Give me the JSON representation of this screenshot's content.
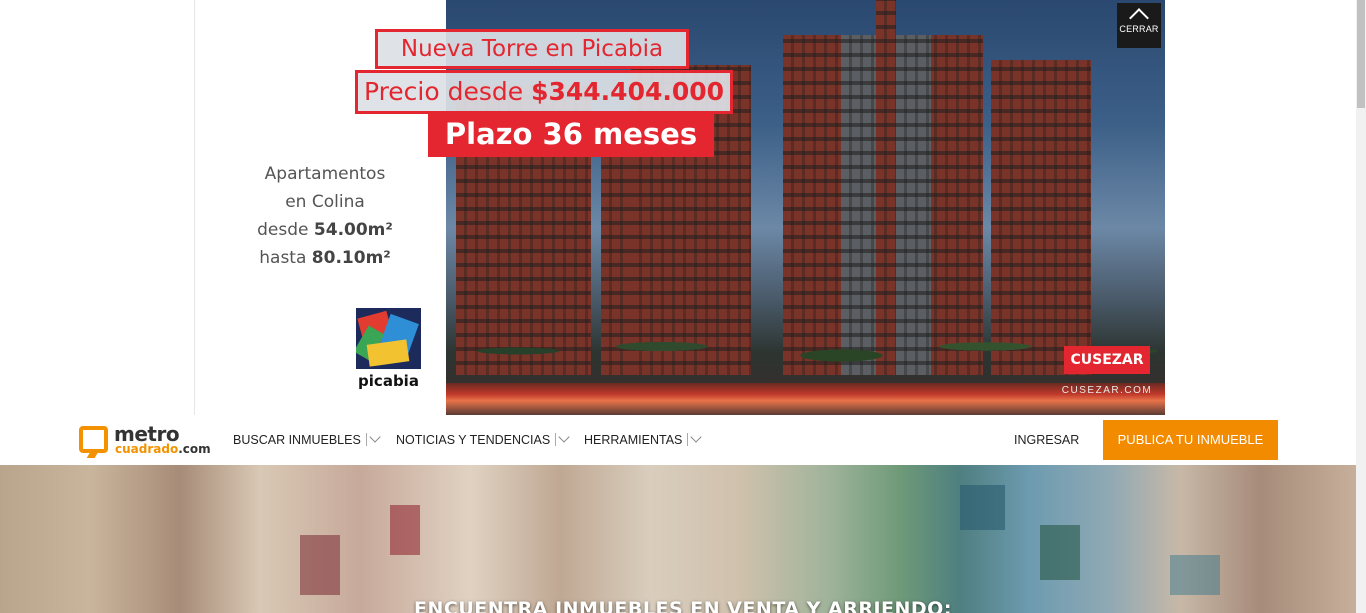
{
  "ad": {
    "headline1": "Nueva Torre en Picabia",
    "headline2_prefix": "Precio desde ",
    "headline2_price": "$344.404.000",
    "headline3": "Plazo 36 meses",
    "copy_line1": "Apartamentos",
    "copy_line2": "en Colina",
    "copy_line3_prefix": "desde ",
    "copy_line3_value": "54.00m²",
    "copy_line4_prefix": "hasta ",
    "copy_line4_value": "80.10m²",
    "project_logo": "picabia",
    "close_label": "CERRAR",
    "brand_logo": "CUSEZAR",
    "brand_url": "CUSEZAR.COM",
    "colors": {
      "accent_red": "#e3262f"
    }
  },
  "header": {
    "logo_top": "metro",
    "logo_bottom": "cuadrado",
    "logo_suffix": ".com",
    "nav": [
      {
        "label": "BUSCAR INMUEBLES",
        "icon": "chevron-down-icon"
      },
      {
        "label": "NOTICIAS Y TENDENCIAS",
        "icon": "chevron-down-icon"
      },
      {
        "label": "HERRAMIENTAS",
        "icon": "chevron-down-icon"
      }
    ],
    "login_label": "INGRESAR",
    "publish_label": "PUBLICA TU INMUEBLE",
    "colors": {
      "brand_orange": "#f38b00"
    }
  },
  "hero": {
    "title": "ENCUENTRA INMUEBLES EN VENTA Y ARRIENDO:"
  }
}
